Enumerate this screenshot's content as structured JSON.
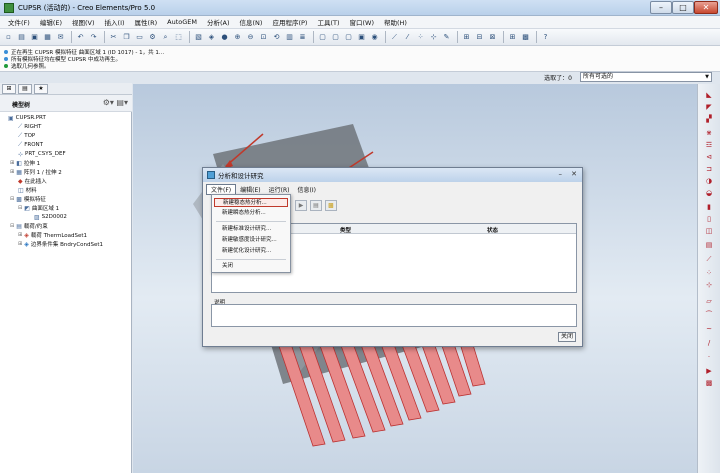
{
  "window": {
    "title": "CUPSR (活动的) - Creo Elements/Pro 5.0"
  },
  "menubar": [
    "文件(F)",
    "编辑(E)",
    "视图(V)",
    "插入(I)",
    "属性(R)",
    "AutoGEM",
    "分析(A)",
    "信息(N)",
    "应用程序(P)",
    "工具(T)",
    "窗口(W)",
    "帮助(H)"
  ],
  "messages": [
    "正在再生 CUPSR 模拟特征 曲面区域 1 (ID 1017) - 1，共 1...",
    "所有模拟特征均在模型 CUPSR 中成功再生。",
    "选取几何参照。"
  ],
  "selection": {
    "label": "选取了：0",
    "filter": "所有可选的"
  },
  "left_panel": {
    "title": "模型树",
    "tree": [
      "CUPSR.PRT",
      "RIGHT",
      "TOP",
      "FRONT",
      "PRT_CSYS_DEF",
      "拉伸 1",
      "阵列 1 / 拉伸 2",
      "在此插入",
      "材料",
      "模拟特征",
      "曲面区域 1",
      "S2D0002",
      "载荷/约束",
      "载荷 ThermLoadSet1",
      "边界条件集 BndryCondSet1"
    ]
  },
  "dialog": {
    "title": "分析和设计研究",
    "menus": [
      "文件(F)",
      "编辑(E)",
      "运行(R)",
      "信息(I)"
    ],
    "table_headers": [
      "类型",
      "状态"
    ],
    "description_label": "说明",
    "close_label": "关闭"
  },
  "file_menu": {
    "items": [
      "新建稳态热分析...",
      "新建瞬态热分析...",
      "新建标准设计研究...",
      "新建敏感度设计研究...",
      "新建优化设计研究...",
      "关闭"
    ]
  },
  "colors": {
    "highlight": "#c0392b",
    "fin": "#e88a8a"
  }
}
